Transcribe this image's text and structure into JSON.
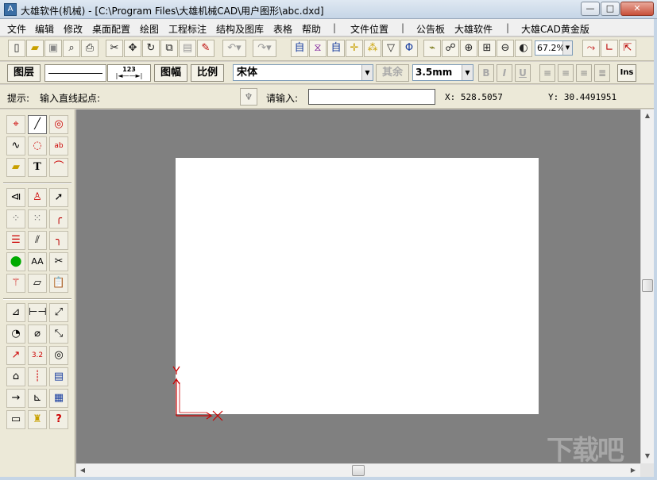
{
  "window": {
    "title": "大雄软件(机械) - [C:\\Program Files\\大雄机械CAD\\用户图形\\abc.dxd]",
    "app_icon": "cad-app-icon",
    "controls": {
      "minimize": "—",
      "maximize": "□",
      "close": "✕"
    }
  },
  "menu": {
    "items": [
      "文件",
      "编辑",
      "修改",
      "桌面配置",
      "绘图",
      "工程标注",
      "结构及图库",
      "表格",
      "帮助",
      "文件位置",
      "公告板",
      "大雄软件",
      "大雄CAD黄金版"
    ],
    "separators": [
      "|",
      "|",
      "|",
      "|"
    ]
  },
  "toolbar1": {
    "icons": [
      "new-file-icon",
      "open-folder-icon",
      "save-icon",
      "print-preview-icon",
      "print-icon",
      "cut-icon",
      "move-icon",
      "rotate-icon",
      "copy-icon",
      "paste-icon",
      "eraser-icon",
      "undo-icon",
      "redo-icon",
      "text-edit-icon",
      "text-style-icon",
      "text-align-icon",
      "snap-icon",
      "snap-points-icon",
      "triangle-icon",
      "mirror-icon",
      "brush-icon",
      "zoom-window-icon",
      "zoom-in-icon",
      "zoom-all-icon",
      "zoom-out-icon",
      "zoom-realtime-icon",
      "layer-icon",
      "ucs-icon",
      "ucs-move-icon"
    ],
    "zoom_value": "67.2%"
  },
  "toolbar2": {
    "layer_label": "图层",
    "sheet_label": "图幅",
    "scale_label": "比例",
    "dim_sample": "123",
    "font_value": "宋体",
    "other_label": "其余",
    "size_value": "3.5mm",
    "bold_label": "B",
    "italic_label": "I",
    "underline_label": "U",
    "ins_label": "Ins"
  },
  "prompt": {
    "label": "提示:",
    "text": "输入直线起点:",
    "input_label": "请输入:",
    "input_value": "",
    "x_readout": "X: 528.5057",
    "y_readout": "Y: 30.4491951"
  },
  "palette": {
    "text_tool_label": "T",
    "text_edit_label": "AA",
    "dim_label_a": "3.2",
    "help_label": "?"
  },
  "canvas": {
    "background": "#808080",
    "paper": "#ffffff",
    "ucs_color": "#cc0000"
  },
  "watermark": "下载吧"
}
